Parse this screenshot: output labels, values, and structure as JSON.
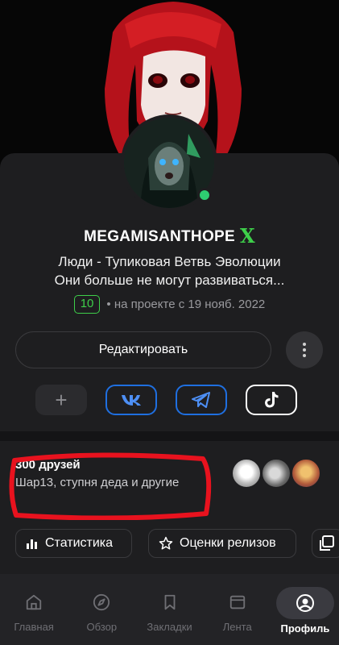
{
  "profile": {
    "username": "MEGAMISANTHOPE",
    "badge": "X",
    "bio_line1": "Люди - Тупиковая Ветвь Эволюции",
    "bio_line2": "Они больше не могут развиваться...",
    "level": "10",
    "joined": "• на проекте с 19 нояб. 2022",
    "online": true
  },
  "actions": {
    "edit_label": "Редактировать"
  },
  "socials": {
    "add_label": "+",
    "items": [
      "vk-icon",
      "telegram-icon",
      "tiktok-icon"
    ],
    "border_color_links": "#1f6fe0"
  },
  "friends": {
    "title": "300 друзей",
    "subtitle": "Шар13, ступня деда и другие"
  },
  "chips": {
    "stats_label": "Статистика",
    "ratings_label": "Оценки релизов"
  },
  "nav": {
    "items": [
      {
        "label": "Главная",
        "icon": "home-icon"
      },
      {
        "label": "Обзор",
        "icon": "compass-icon"
      },
      {
        "label": "Закладки",
        "icon": "bookmark-icon"
      },
      {
        "label": "Лента",
        "icon": "feed-icon"
      },
      {
        "label": "Профиль",
        "icon": "profile-icon",
        "active": true
      }
    ]
  },
  "colors": {
    "accent_green": "#3ecf4a",
    "highlight_ring": "#e8121e",
    "card_bg": "#1e1e20"
  }
}
